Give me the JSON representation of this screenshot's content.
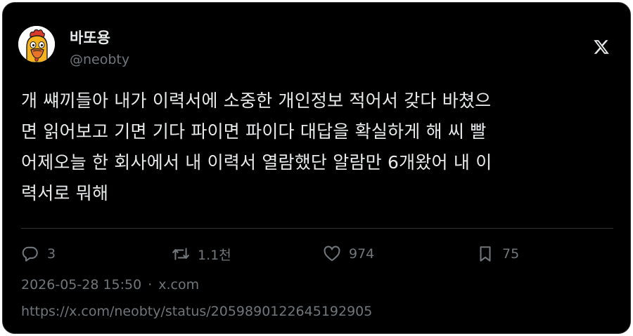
{
  "author": {
    "display_name": "바또용",
    "handle": "@neobty"
  },
  "tweet": {
    "text": "개 썌끼들아 내가 이력서에 소중한 개인정보 적어서 갖다 바쳤으\n면 읽어보고 기면 기다 파이면 파이다 대답을 확실하게 해 씨 빨\n어제오늘 한 회사에서 내 이력서 열람했단 알람만 6개왔어 내 이\n력서로 뭐해"
  },
  "stats": {
    "replies": "3",
    "retweets": "1.1천",
    "likes": "974",
    "bookmarks": "75"
  },
  "meta": {
    "timestamp": "2026-05-28 15:50",
    "separator": "·",
    "source": "x.com"
  },
  "url": "https://x.com/neobty/status/2059890122645192905",
  "icons": {
    "brand": "x-logo-icon",
    "reply": "reply-icon",
    "retweet": "retweet-icon",
    "like": "heart-icon",
    "bookmark": "bookmark-icon"
  },
  "colors": {
    "background": "#000000",
    "text": "#e7e9ea",
    "muted": "#71767b",
    "border": "#2f3336"
  }
}
